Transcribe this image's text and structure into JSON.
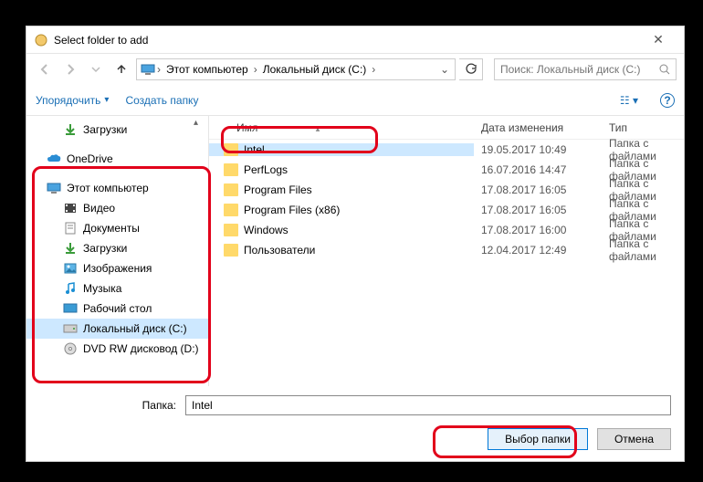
{
  "window": {
    "title": "Select folder to add"
  },
  "breadcrumb": {
    "seg1": "Этот компьютер",
    "seg2": "Локальный диск (C:)"
  },
  "search": {
    "placeholder": "Поиск: Локальный диск (C:)"
  },
  "toolbar": {
    "organize": "Упорядочить",
    "newfolder": "Создать папку"
  },
  "sidebar": {
    "downloads": "Загрузки",
    "onedrive": "OneDrive",
    "thispc": "Этот компьютер",
    "video": "Видео",
    "documents": "Документы",
    "downloads2": "Загрузки",
    "pictures": "Изображения",
    "music": "Музыка",
    "desktop": "Рабочий стол",
    "localdisk": "Локальный диск (C:)",
    "dvd": "DVD RW дисковод (D:)"
  },
  "columns": {
    "name": "Имя",
    "date": "Дата изменения",
    "type": "Тип"
  },
  "files": [
    {
      "name": "Intel",
      "date": "19.05.2017 10:49",
      "type": "Папка с файлами",
      "selected": true
    },
    {
      "name": "PerfLogs",
      "date": "16.07.2016 14:47",
      "type": "Папка с файлами"
    },
    {
      "name": "Program Files",
      "date": "17.08.2017 16:05",
      "type": "Папка с файлами"
    },
    {
      "name": "Program Files (x86)",
      "date": "17.08.2017 16:05",
      "type": "Папка с файлами"
    },
    {
      "name": "Windows",
      "date": "17.08.2017 16:00",
      "type": "Папка с файлами"
    },
    {
      "name": "Пользователи",
      "date": "12.04.2017 12:49",
      "type": "Папка с файлами"
    }
  ],
  "footer": {
    "folder_label": "Папка:",
    "folder_value": "Intel",
    "select": "Выбор папки",
    "cancel": "Отмена"
  }
}
